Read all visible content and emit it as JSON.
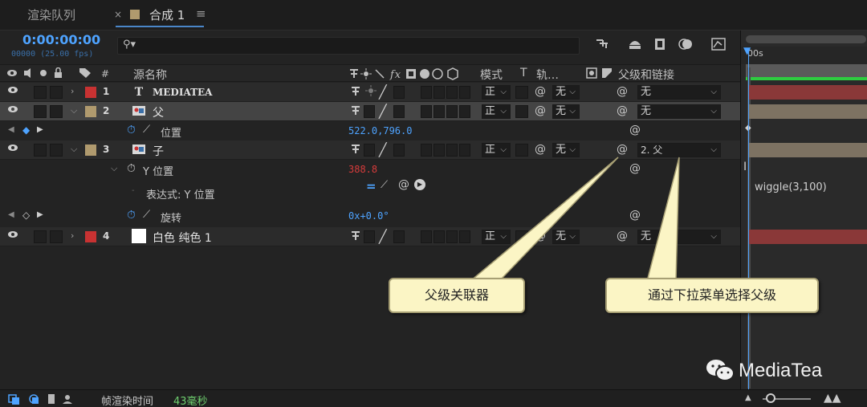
{
  "tabs": [
    {
      "label": "渲染队列"
    },
    {
      "label": "合成 1",
      "close": "×",
      "menu": "≡"
    }
  ],
  "comp": {
    "timecode": "0:00:00:00",
    "frame_info": "00000 (25.00 fps)",
    "search_glyph": "⚲▾"
  },
  "timeline_ruler": {
    "start_label": "00s"
  },
  "header": {
    "label_col": "#",
    "source_name": "源名称",
    "mode": "模式",
    "trkmat_t": "T",
    "trkmat": "轨…",
    "parent": "父级和链接"
  },
  "layers": [
    {
      "num": "1",
      "type_icon": "T",
      "name": "MEDIATEA",
      "label_color": "#c83232",
      "expanded": false,
      "mode": "正",
      "trkmat": "无",
      "parent": "无"
    },
    {
      "num": "2",
      "type_icon": "comp",
      "name": "父",
      "label_color": "#b09a6e",
      "expanded": true,
      "selected": true,
      "mode": "正",
      "trkmat": "无",
      "parent": "无"
    },
    {
      "num": "3",
      "type_icon": "comp",
      "name": "子",
      "label_color": "#b09a6e",
      "expanded": true,
      "mode": "正",
      "trkmat": "无",
      "parent": "2. 父"
    },
    {
      "num": "4",
      "type_icon": "solid",
      "name": "白色 纯色 1",
      "label_color": "#c83232",
      "expanded": false,
      "mode": "正",
      "trkmat": "无",
      "parent": "无"
    }
  ],
  "properties": {
    "position": {
      "name": "位置",
      "value": "522.0,796.0"
    },
    "y_position": {
      "name": "Y 位置",
      "value": "388.8",
      "value_color": "#d63b3b"
    },
    "expression": {
      "name": "表达式: Y 位置",
      "code": "wiggle(3,100)"
    },
    "rotation": {
      "name": "旋转",
      "value": "0x+0.0°"
    }
  },
  "callouts": {
    "pickwhip": "父级关联器",
    "dropdown": "通过下拉菜单选择父级"
  },
  "footer": {
    "render_time_label": "帧渲染时间",
    "render_time_value": "43毫秒"
  },
  "watermark": "MediaTea",
  "colors": {
    "accent_blue": "#4ea3ff",
    "green_bar": "#2ecc40",
    "red_bar": "#8a3838",
    "tan_bar": "#7d7262"
  }
}
